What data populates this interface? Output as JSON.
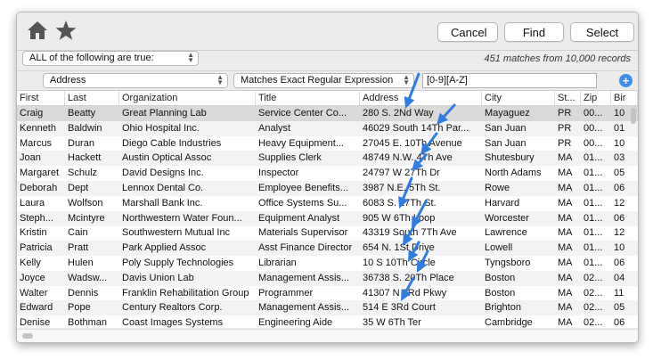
{
  "toolbar": {
    "home_icon": "home-icon",
    "star_icon": "star-icon",
    "cancel_label": "Cancel",
    "find_label": "Find",
    "select_label": "Select"
  },
  "filter": {
    "match_mode": "ALL of the following are true:",
    "matches_text": "451 matches from 10,000 records"
  },
  "criterion": {
    "field": "Address",
    "operator": "Matches Exact Regular Expression",
    "value": "[0-9][A-Z]"
  },
  "table": {
    "columns": [
      "First",
      "Last",
      "Organization",
      "Title",
      "Address",
      "City",
      "St...",
      "Zip",
      "Bir"
    ],
    "rows": [
      [
        "Craig",
        "Beatty",
        "Great Planning Lab",
        "Service Center Co...",
        "280 S. 2Nd Way",
        "Mayaguez",
        "PR",
        "00...",
        "10"
      ],
      [
        "Kenneth",
        "Baldwin",
        "Ohio Hospital Inc.",
        "Analyst",
        "46029 South 14Th Par...",
        "San Juan",
        "PR",
        "00...",
        "01"
      ],
      [
        "Marcus",
        "Duran",
        "Diego Cable Industries",
        "Heavy Equipment...",
        "27045 E. 10Th Avenue",
        "San Juan",
        "PR",
        "00...",
        "10"
      ],
      [
        "Joan",
        "Hackett",
        "Austin Optical Assoc",
        "Supplies Clerk",
        "48749 N.W. 4Th Ave",
        "Shutesbury",
        "MA",
        "01...",
        "03"
      ],
      [
        "Margaret",
        "Schulz",
        "David Designs Inc.",
        "Inspector",
        "24797 W 27Th Dr",
        "North Adams",
        "MA",
        "01...",
        "05"
      ],
      [
        "Deborah",
        "Dept",
        "Lennox Dental Co.",
        "Employee Benefits...",
        "3987 N.E. 5Th St.",
        "Rowe",
        "MA",
        "01...",
        "06"
      ],
      [
        "Laura",
        "Wolfson",
        "Marshall Bank Inc.",
        "Office Systems Su...",
        "6083 S. 27Th St.",
        "Harvard",
        "MA",
        "01...",
        "12"
      ],
      [
        "Steph...",
        "Mcintyre",
        "Northwestern Water Foun...",
        "Equipment Analyst",
        "905 W 6Th Loop",
        "Worcester",
        "MA",
        "01...",
        "06"
      ],
      [
        "Kristin",
        "Cain",
        "Southwestern Mutual Inc",
        "Materials Supervisor",
        "43319 South 7Th Ave",
        "Lawrence",
        "MA",
        "01...",
        "12"
      ],
      [
        "Patricia",
        "Pratt",
        "Park Applied Assoc",
        "Asst Finance Director",
        "654 N. 1St Drive",
        "Lowell",
        "MA",
        "01...",
        "10"
      ],
      [
        "Kelly",
        "Hulen",
        "Poly Supply Technologies",
        "Librarian",
        "10 S 10Th Circle",
        "Tyngsboro",
        "MA",
        "01...",
        "06"
      ],
      [
        "Joyce",
        "Wadsw...",
        "Davis Union Lab",
        "Management Assis...",
        "36738 S. 20Th Place",
        "Boston",
        "MA",
        "02...",
        "04"
      ],
      [
        "Walter",
        "Dennis",
        "Franklin Rehabilitation Group",
        "Programmer",
        "41307 N 3Rd Pkwy",
        "Boston",
        "MA",
        "02...",
        "11"
      ],
      [
        "Edward",
        "Pope",
        "Century Realtors Corp.",
        "Management Assis...",
        "514 E 3Rd Court",
        "Brighton",
        "MA",
        "02...",
        "05"
      ],
      [
        "Denise",
        "Bothman",
        "Coast Images Systems",
        "Engineering Aide",
        "35 W 6Th Ter",
        "Cambridge",
        "MA",
        "02...",
        "06"
      ]
    ]
  },
  "colors": {
    "accent": "#3b8ff0",
    "arrow": "#2f7de1",
    "selected_row": "#d9d9d9"
  }
}
